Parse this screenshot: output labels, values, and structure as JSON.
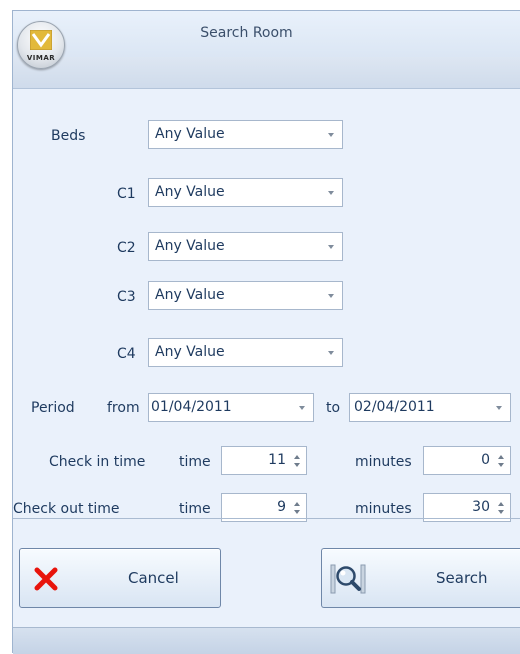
{
  "window": {
    "title": "Search Room",
    "logo_text": "VIMAR"
  },
  "form": {
    "beds": {
      "label": "Beds",
      "value": "Any Value"
    },
    "c1": {
      "label": "C1",
      "value": "Any Value"
    },
    "c2": {
      "label": "C2",
      "value": "Any Value"
    },
    "c3": {
      "label": "C3",
      "value": "Any Value"
    },
    "c4": {
      "label": "C4",
      "value": "Any Value"
    },
    "period": {
      "label": "Period",
      "from_label": "from",
      "from_value": "01/04/2011",
      "to_label": "to",
      "to_value": "02/04/2011"
    },
    "check_in": {
      "label": "Check in time",
      "time_label": "time",
      "time_value": "11",
      "minutes_label": "minutes",
      "minutes_value": "0"
    },
    "check_out": {
      "label": "Check out time",
      "time_label": "time",
      "time_value": "9",
      "minutes_label": "minutes",
      "minutes_value": "30"
    }
  },
  "buttons": {
    "cancel": "Cancel",
    "search": "Search"
  },
  "colors": {
    "accent": "#1e3a5f",
    "cancel_icon": "#e8140c"
  },
  "icons": {
    "logo": "vimar-logo-icon",
    "cancel": "red-x-icon",
    "search": "search-magnifier-icon"
  }
}
